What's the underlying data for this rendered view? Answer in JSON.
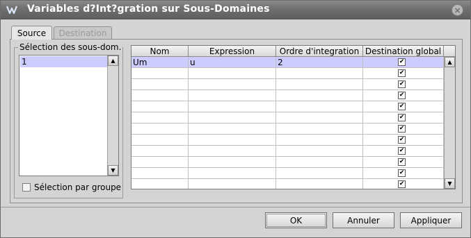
{
  "window": {
    "title": "Variables d?Int?gration sur Sous-Domaines",
    "app_icon": "app-logo-icon",
    "close_icon": "close-icon",
    "close_glyph": "×"
  },
  "tabs": [
    {
      "label": "Source",
      "active": true
    },
    {
      "label": "Destination",
      "active": false
    }
  ],
  "subdomains": {
    "group_title": "Sélection des sous-dom.",
    "items": [
      "1"
    ],
    "selected": "1",
    "scroll_up": "▲",
    "scroll_down": "▼"
  },
  "group_selection": {
    "label": "Sélection par groupe",
    "checked": false
  },
  "table": {
    "headers": [
      "Nom",
      "Expression",
      "Ordre d'integration",
      "Destination global"
    ],
    "rows": [
      {
        "nom": "Um",
        "expression": "u",
        "ordre": "2",
        "dest_global": true,
        "selected": true
      },
      {
        "nom": "",
        "expression": "",
        "ordre": "",
        "dest_global": true
      },
      {
        "nom": "",
        "expression": "",
        "ordre": "",
        "dest_global": true
      },
      {
        "nom": "",
        "expression": "",
        "ordre": "",
        "dest_global": true
      },
      {
        "nom": "",
        "expression": "",
        "ordre": "",
        "dest_global": true
      },
      {
        "nom": "",
        "expression": "",
        "ordre": "",
        "dest_global": true
      },
      {
        "nom": "",
        "expression": "",
        "ordre": "",
        "dest_global": true
      },
      {
        "nom": "",
        "expression": "",
        "ordre": "",
        "dest_global": true
      },
      {
        "nom": "",
        "expression": "",
        "ordre": "",
        "dest_global": true
      },
      {
        "nom": "",
        "expression": "",
        "ordre": "",
        "dest_global": true
      },
      {
        "nom": "",
        "expression": "",
        "ordre": "",
        "dest_global": true
      },
      {
        "nom": "",
        "expression": "",
        "ordre": "",
        "dest_global": true
      }
    ],
    "check_glyph": "✔",
    "scroll_up": "▲",
    "scroll_down": "▼"
  },
  "buttons": {
    "ok": "OK",
    "cancel": "Annuler",
    "apply": "Appliquer"
  },
  "colors": {
    "selection": "#ccccff",
    "titlebar": "#6f6f6f",
    "window_bg": "#d4d4d4"
  }
}
